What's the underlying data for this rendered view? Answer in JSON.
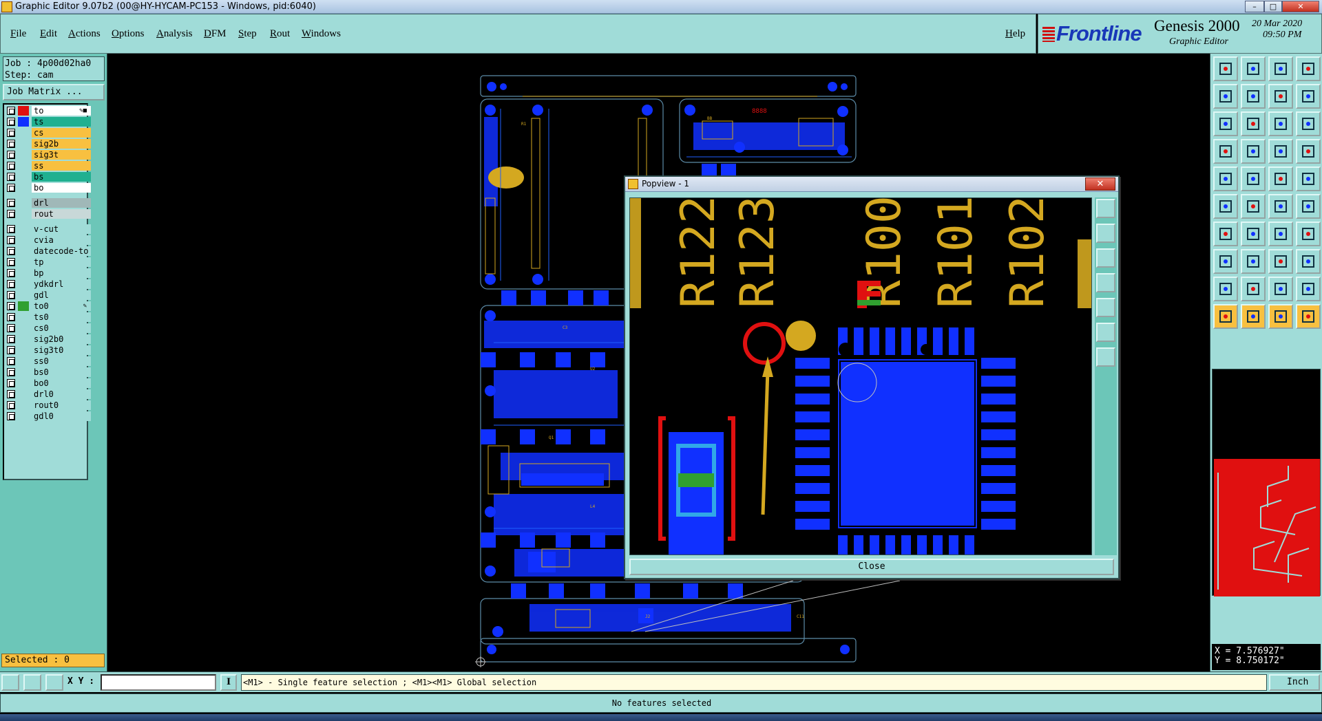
{
  "window": {
    "title": "Graphic Editor 9.07b2 (00@HY-HYCAM-PC153 - Windows, pid:6040)"
  },
  "menu": {
    "items": [
      "File",
      "Edit",
      "Actions",
      "Options",
      "Analysis",
      "DFM",
      "Step",
      "Rout",
      "Windows"
    ],
    "help": "Help"
  },
  "brand": {
    "logo": "Frontline",
    "product": "Genesis 2000",
    "subtitle": "Graphic Editor",
    "date": "20 Mar 2020",
    "time": "09:50 PM"
  },
  "job": {
    "job_line": "Job : 4p00d02ha0",
    "step_line": "Step: cam",
    "matrix_button": "Job Matrix ..."
  },
  "layers": [
    {
      "name": "to",
      "color": "#ffffff",
      "swatch": "#e01010",
      "mark": "✎■",
      "active": true
    },
    {
      "name": "ts",
      "color": "#20b090",
      "swatch": "#1030ff"
    },
    {
      "name": "cs",
      "color": "#f8c040",
      "swatch": ""
    },
    {
      "name": "sig2b",
      "color": "#f8c040",
      "swatch": ""
    },
    {
      "name": "sig3t",
      "color": "#f8c040",
      "swatch": ""
    },
    {
      "name": "ss",
      "color": "#f8c040",
      "swatch": ""
    },
    {
      "name": "bs",
      "color": "#20b090",
      "swatch": ""
    },
    {
      "name": "bo",
      "color": "#ffffff",
      "swatch": ""
    },
    {
      "name": "drl",
      "color": "#a0b8b8",
      "swatch": ""
    },
    {
      "name": "rout",
      "color": "#c8d8d8",
      "swatch": ""
    },
    {
      "name": "v-cut",
      "color": "#a0dcd8",
      "swatch": ""
    },
    {
      "name": "cvia",
      "color": "#a0dcd8",
      "swatch": ""
    },
    {
      "name": "datecode-to",
      "color": "#a0dcd8",
      "swatch": ""
    },
    {
      "name": "tp",
      "color": "#a0dcd8",
      "swatch": ""
    },
    {
      "name": "bp",
      "color": "#a0dcd8",
      "swatch": ""
    },
    {
      "name": "ydkdrl",
      "color": "#a0dcd8",
      "swatch": ""
    },
    {
      "name": "gdl",
      "color": "#a0dcd8",
      "swatch": ""
    },
    {
      "name": "to0",
      "color": "#a0dcd8",
      "swatch": "#30a030",
      "mark": "✎"
    },
    {
      "name": "ts0",
      "color": "#a0dcd8",
      "swatch": ""
    },
    {
      "name": "cs0",
      "color": "#a0dcd8",
      "swatch": ""
    },
    {
      "name": "sig2b0",
      "color": "#a0dcd8",
      "swatch": ""
    },
    {
      "name": "sig3t0",
      "color": "#a0dcd8",
      "swatch": ""
    },
    {
      "name": "ss0",
      "color": "#a0dcd8",
      "swatch": ""
    },
    {
      "name": "bs0",
      "color": "#a0dcd8",
      "swatch": ""
    },
    {
      "name": "bo0",
      "color": "#a0dcd8",
      "swatch": ""
    },
    {
      "name": "drl0",
      "color": "#a0dcd8",
      "swatch": ""
    },
    {
      "name": "rout0",
      "color": "#a0dcd8",
      "swatch": ""
    },
    {
      "name": "gdl0",
      "color": "#a0dcd8",
      "swatch": ""
    }
  ],
  "selected": "Selected : 0",
  "popview": {
    "title": "Popview - 1",
    "close": "Close",
    "refdes": [
      "R122",
      "R123",
      "R100",
      "R101",
      "R102"
    ]
  },
  "command_bar": {
    "xy_label": "X Y :",
    "xy_value": "",
    "info": "I",
    "hint": "<M1> - Single feature selection ; <M1><M1> Global selection",
    "units": "Inch"
  },
  "coordinates": {
    "x": "X = 7.576927\"",
    "y": "Y = 8.750172\""
  },
  "status": "No features selected",
  "colors": {
    "panel": "#a0dcd8",
    "copper": "#1030ff",
    "silkscreen": "#d4a820",
    "highlight": "#e01010"
  }
}
